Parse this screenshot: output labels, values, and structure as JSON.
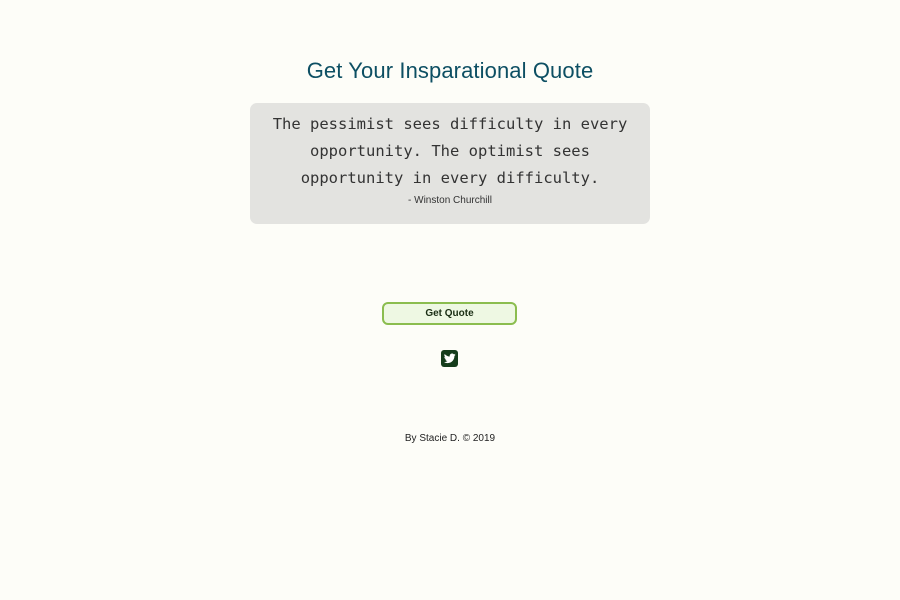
{
  "header": {
    "title": "Get Your Insparational Quote"
  },
  "quote": {
    "text": "The pessimist sees difficulty in every opportunity. The optimist sees opportunity in every difficulty.",
    "author": "- Winston Churchill"
  },
  "actions": {
    "get_quote_label": "Get Quote",
    "twitter_icon": "twitter-icon"
  },
  "footer": {
    "text": "By Stacie D. © 2019"
  },
  "colors": {
    "background": "#fdfdf8",
    "title": "#0d4f63",
    "card": "#e3e3e0",
    "button_border": "#8bbd4f",
    "button_bg": "#eef8e3",
    "twitter_bg": "#153d1c"
  }
}
